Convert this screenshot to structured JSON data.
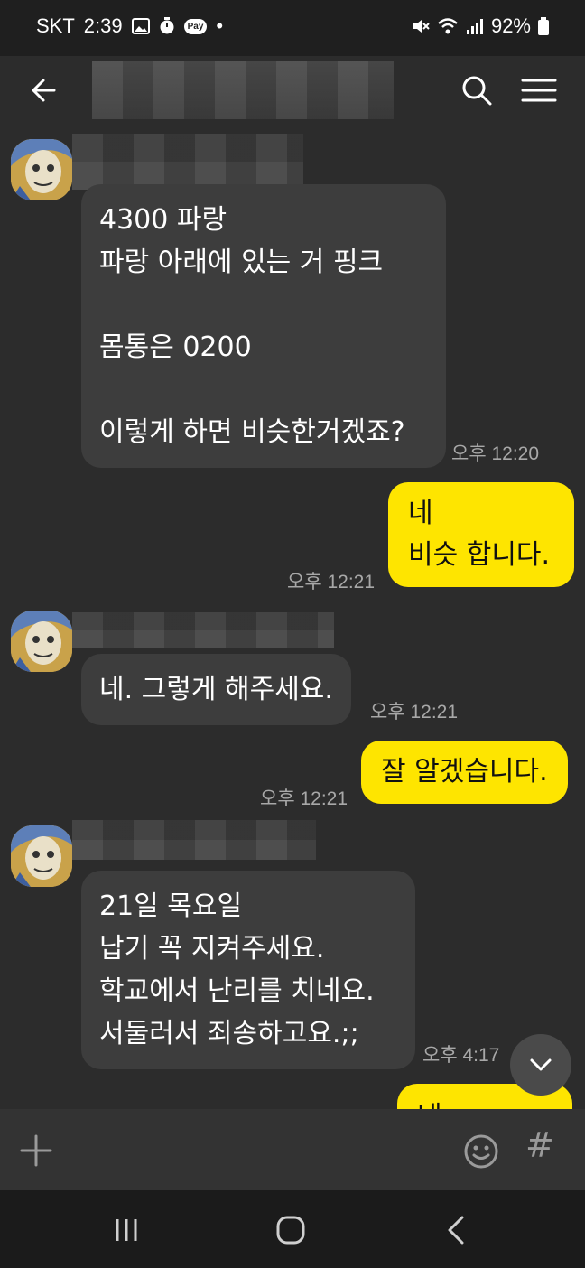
{
  "status": {
    "carrier": "SKT",
    "time": "2:39",
    "pay_badge": "Pay",
    "dot": "•",
    "battery": "92%"
  },
  "header": {
    "back_icon": "arrow-left-icon",
    "search_icon": "search-icon",
    "menu_icon": "hamburger-menu-icon"
  },
  "messages": {
    "m1": {
      "text": "4300 파랑\n파랑 아래에 있는 거 핑크\n\n몸통은 0200\n\n이렇게 하면 비슷한거겠죠?",
      "time": "오후 12:20"
    },
    "m2": {
      "text": "네\n비슷 합니다.",
      "time": "오후 12:21"
    },
    "m3": {
      "text": "네. 그렇게 해주세요.",
      "time": "오후 12:21"
    },
    "m4": {
      "text": "잘 알겠습니다.",
      "time": "오후 12:21"
    },
    "m5": {
      "text": "21일 목요일\n납기 꼭 지켜주세요.\n학교에서 난리를 치네요.\n서둘러서 죄송하고요.;;",
      "time": "오후 4:17"
    },
    "m6": {
      "text": "네"
    }
  },
  "input_bar": {
    "plus_icon": "plus-icon",
    "emoji_icon": "emoji-icon",
    "hash_label": "#"
  },
  "nav": {
    "recents_icon": "recents-icon",
    "home_icon": "home-icon",
    "back_icon": "back-chevron-icon"
  },
  "colors": {
    "background": "#2c2c2c",
    "incoming_bubble": "#3d3d3d",
    "outgoing_bubble": "#fee500"
  }
}
